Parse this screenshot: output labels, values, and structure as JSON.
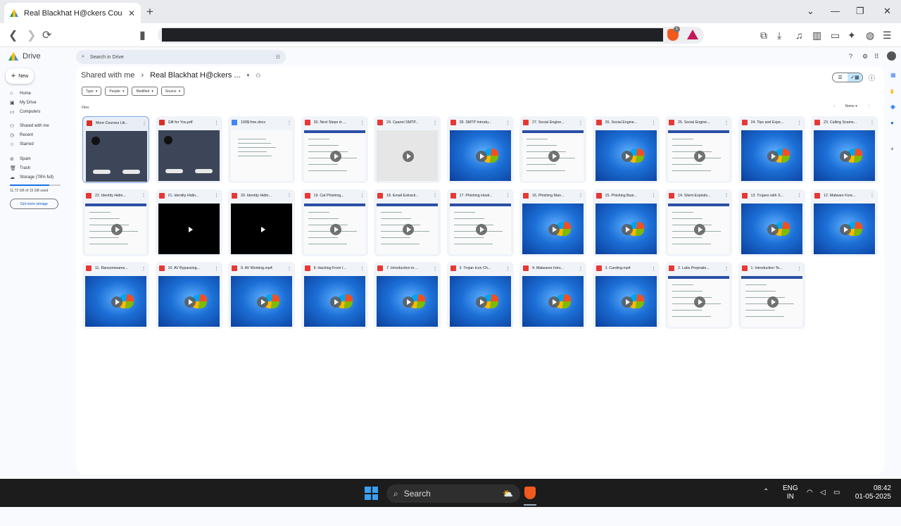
{
  "browser": {
    "tab_title": "Real Blackhat H@ckers Course",
    "new_tab": "+",
    "close_tab": "✕",
    "window_controls": [
      "⌄",
      "—",
      "❐",
      "✕"
    ],
    "brave_badge": "1"
  },
  "drive": {
    "logo_text": "Drive",
    "search_placeholder": "Search in Drive",
    "new_label": "New",
    "sidebar": [
      {
        "label": "Home",
        "icon": "home-icon"
      },
      {
        "label": "My Drive",
        "icon": "drive-icon"
      },
      {
        "label": "Computers",
        "icon": "computer-icon"
      },
      {
        "label": "Shared with me",
        "icon": "people-icon"
      },
      {
        "label": "Recent",
        "icon": "clock-icon"
      },
      {
        "label": "Starred",
        "icon": "star-icon"
      },
      {
        "label": "Spam",
        "icon": "spam-icon"
      },
      {
        "label": "Trash",
        "icon": "trash-icon"
      },
      {
        "label": "Storage (78% full)",
        "icon": "cloud-icon"
      }
    ],
    "storage_fraction": 0.78,
    "storage_used": "11.72 GB of 15 GB used",
    "get_more": "Get more storage",
    "breadcrumb": {
      "parent": "Shared with me",
      "current": "Real Blackhat H@ckers ..."
    },
    "filters": [
      "Type",
      "People",
      "Modified",
      "Source"
    ],
    "files_label": "Files",
    "sort_label": "Name",
    "files": [
      {
        "name": "More Courses Lik...",
        "kind": "pdf",
        "thumb": "dark"
      },
      {
        "name": "Gift for You.pdf",
        "kind": "pdf",
        "thumb": "dark"
      },
      {
        "name": "100$ free.docx",
        "kind": "doc",
        "thumb": "white"
      },
      {
        "name": "30. Next Steps in ...",
        "kind": "vid",
        "thumb": "white"
      },
      {
        "name": "29. Cpanel SMTP...",
        "kind": "vid",
        "thumb": "gray"
      },
      {
        "name": "28. SMTP Introdu...",
        "kind": "vid",
        "thumb": "win"
      },
      {
        "name": "27. Social Engine...",
        "kind": "vid",
        "thumb": "white"
      },
      {
        "name": "26. Social Engine...",
        "kind": "vid",
        "thumb": "win"
      },
      {
        "name": "25. Social Engine...",
        "kind": "vid",
        "thumb": "white"
      },
      {
        "name": "24. Tips and Expe...",
        "kind": "vid",
        "thumb": "win"
      },
      {
        "name": "23. Calling Scams...",
        "kind": "vid",
        "thumb": "win"
      },
      {
        "name": "22. Identity Hidin...",
        "kind": "vid",
        "thumb": "white"
      },
      {
        "name": "21. Identity Hidin...",
        "kind": "vid",
        "thumb": "black"
      },
      {
        "name": "20. Identity Hidin...",
        "kind": "vid",
        "thumb": "black"
      },
      {
        "name": "19. Cat Phishing...",
        "kind": "vid",
        "thumb": "white"
      },
      {
        "name": "18. Email Extracti...",
        "kind": "vid",
        "thumb": "white"
      },
      {
        "name": "17. Phishing Hosti...",
        "kind": "vid",
        "thumb": "white"
      },
      {
        "name": "16. Phishing Man...",
        "kind": "vid",
        "thumb": "win"
      },
      {
        "name": "15. Phishing Basi...",
        "kind": "vid",
        "thumb": "win"
      },
      {
        "name": "14. Silent Exploits...",
        "kind": "vid",
        "thumb": "white"
      },
      {
        "name": "13. Trojans with S...",
        "kind": "vid",
        "thumb": "win"
      },
      {
        "name": "12. Malware Fore...",
        "kind": "vid",
        "thumb": "win"
      },
      {
        "name": "11. Ransomwares...",
        "kind": "vid",
        "thumb": "win"
      },
      {
        "name": "10. AV Bypassing...",
        "kind": "vid",
        "thumb": "win"
      },
      {
        "name": "9. AV Working.mp4",
        "kind": "vid",
        "thumb": "win"
      },
      {
        "name": "8. Hacking From I...",
        "kind": "vid",
        "thumb": "win"
      },
      {
        "name": "7. Introduction to ...",
        "kind": "vid",
        "thumb": "win"
      },
      {
        "name": "6. Trojan Icon Ch...",
        "kind": "vid",
        "thumb": "win"
      },
      {
        "name": "4. Malwares Intro...",
        "kind": "vid",
        "thumb": "win"
      },
      {
        "name": "3. Carding.mp4",
        "kind": "vid",
        "thumb": "win"
      },
      {
        "name": "2. Labs Prepratio...",
        "kind": "vid",
        "thumb": "white"
      },
      {
        "name": "1. Introduction To...",
        "kind": "vid",
        "thumb": "white"
      }
    ]
  },
  "taskbar": {
    "search_label": "Search",
    "lang": "ENG",
    "region": "IN",
    "time": "08:42",
    "date": "01-05-2025"
  }
}
